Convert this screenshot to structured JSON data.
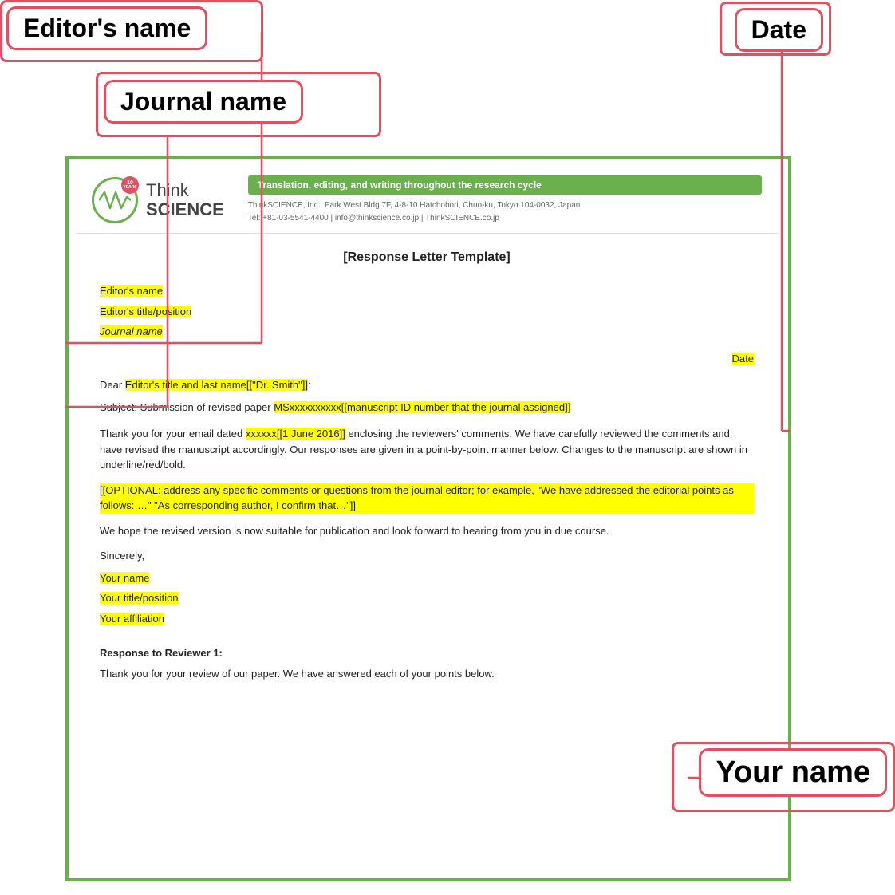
{
  "annotations": {
    "editors_name_label": "Editor's name",
    "date_label": "Date",
    "journal_name_label": "Journal name",
    "your_name_label": "Your name"
  },
  "header": {
    "years": "10",
    "years_suffix": "YEARS",
    "think": "Think",
    "science": "SCIENCE",
    "tagline": "Translation, editing, and writing throughout the research cycle",
    "company": "ThinkSCIENCE, Inc.",
    "address": "Park West Bldg 7F, 4-8-10 Hatchobori, Chuo-ku, Tokyo 104-0032, Japan",
    "tel": "Tel: +81-03-5541-4400",
    "email": "info@thinkscience.co.jp",
    "website": "ThinkSCIENCE.co.jp"
  },
  "letter": {
    "title": "[Response Letter Template]",
    "editors_name": "Editor's name",
    "editors_title": "Editor's title/position",
    "journal_name": "Journal name",
    "date": "Date",
    "dear": "Dear ",
    "dear_highlight": "Editor's title and last name[[\"Dr. Smith\"]]",
    "dear_end": ":",
    "subject_prefix": "Subject:  Submission of revised paper  ",
    "subject_highlight": "MSxxxxxxxxxx[[manuscript ID number that the journal assigned]]",
    "body1_pre": "Thank you for your email dated ",
    "body1_highlight": "xxxxxx[[1 June 2016]]",
    "body1_post": " enclosing the reviewers' comments. We have carefully reviewed the comments and have revised the manuscript accordingly. Our responses are given in a point-by-point manner below. Changes to the manuscript are shown in underline/red/bold.",
    "optional": "[[OPTIONAL: address any specific comments or questions from the journal editor; for example, \"We have addressed the editorial points as follows: …\" \"As corresponding author, I confirm that…\"]]",
    "hope": "We hope the revised version is now suitable for publication and look forward to hearing from you in due course.",
    "sincerely": "Sincerely,",
    "your_name": "Your name",
    "your_title": "Your title/position",
    "your_affiliation": "Your affiliation",
    "response_header": "Response to Reviewer 1:",
    "response_body": "Thank you for your review of our paper. We have answered each of your points below."
  }
}
